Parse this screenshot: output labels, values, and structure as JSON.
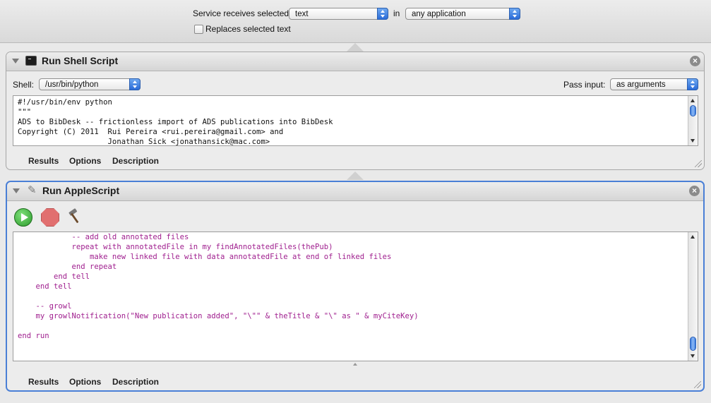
{
  "service": {
    "receives_label": "Service receives selected",
    "input_type": "text",
    "in_label": "in",
    "application": "any application",
    "replaces_label": "Replaces selected text"
  },
  "shell_action": {
    "title": "Run Shell Script",
    "shell_label": "Shell:",
    "shell_value": "/usr/bin/python",
    "pass_input_label": "Pass input:",
    "pass_input_value": "as arguments",
    "code": [
      "#!/usr/bin/env python",
      "\"\"\"",
      "ADS to BibDesk -- frictionless import of ADS publications into BibDesk",
      "Copyright (C) 2011  Rui Pereira <rui.pereira@gmail.com> and",
      "                    Jonathan Sick <jonathansick@mac.com>"
    ],
    "tabs": [
      "Results",
      "Options",
      "Description"
    ]
  },
  "apple_action": {
    "title": "Run AppleScript",
    "code": [
      "            -- add old annotated files",
      "            repeat with annotatedFile in my findAnnotatedFiles(thePub)",
      "                make new linked file with data annotatedFile at end of linked files",
      "            end repeat",
      "        end tell",
      "    end tell",
      "",
      "    -- growl",
      "    my growlNotification(\"New publication added\", \"\\\"\" & theTitle & \"\\\" as \" & myCiteKey)",
      "",
      "end run"
    ],
    "tabs": [
      "Results",
      "Options",
      "Description"
    ]
  },
  "icons": {
    "close": "close-icon",
    "disclosure": "disclosure-triangle-icon",
    "terminal": "terminal-icon",
    "script": "applescript-icon",
    "run": "run-icon",
    "stop": "stop-icon",
    "compile": "hammer-icon"
  },
  "colors": {
    "selected_border": "#4a7fd6",
    "applescript_text": "#a0208f",
    "scroll_thumb": "#3d7fe0"
  }
}
